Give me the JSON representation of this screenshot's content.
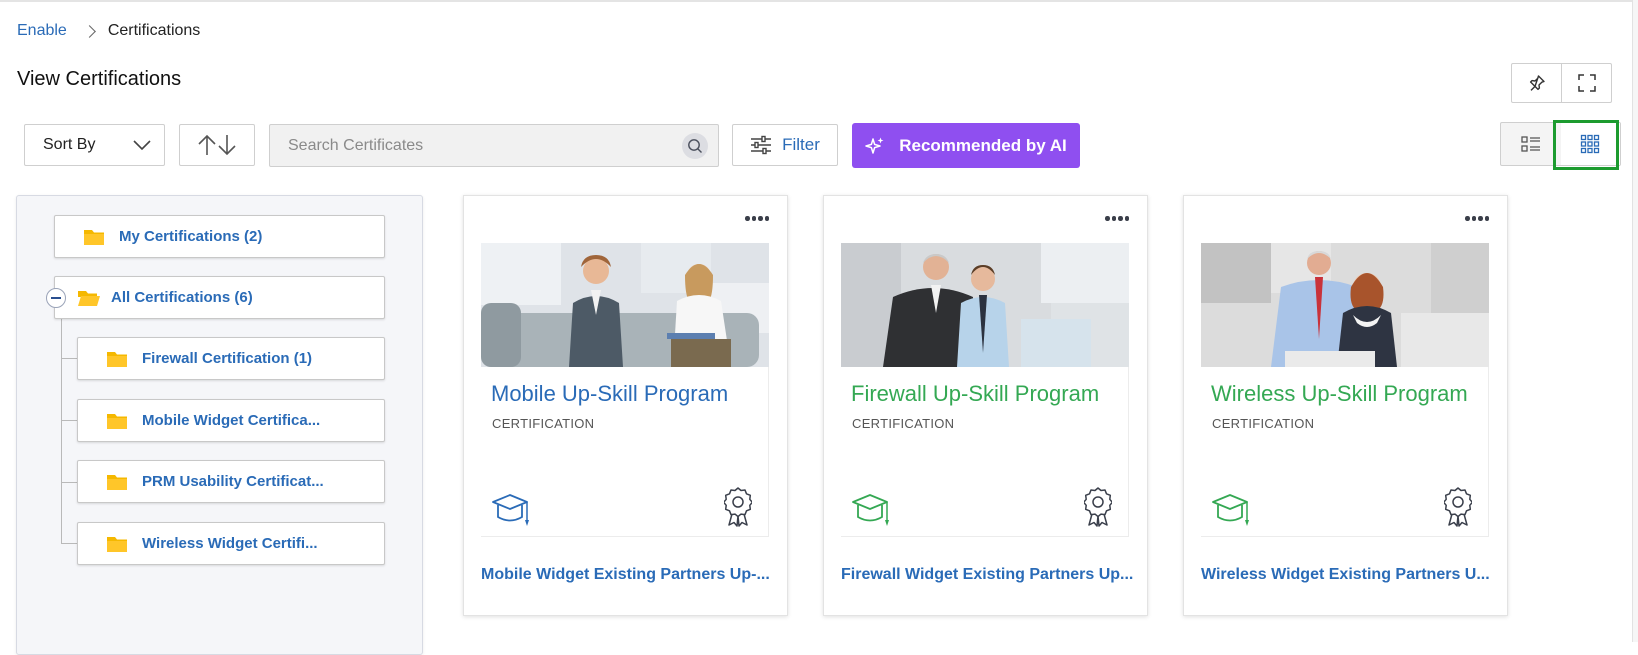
{
  "breadcrumb": {
    "root": "Enable",
    "current": "Certifications"
  },
  "page": {
    "title": "View Certifications"
  },
  "toolbar": {
    "sort_label": "Sort By",
    "search_placeholder": "Search Certificates",
    "filter_label": "Filter",
    "ai_label": "Recommended by AI"
  },
  "tree": {
    "my": "My Certifications (2)",
    "all": "All Certifications (6)",
    "children": [
      "Firewall Certification (1)",
      "Mobile Widget Certifica...",
      "PRM Usability Certificat...",
      "Wireless Widget Certifi..."
    ]
  },
  "cards": [
    {
      "title": "Mobile Up-Skill Program",
      "type": "CERTIFICATION",
      "footer": "Mobile Widget Existing Partners Up-...",
      "accent": "#2a6bb7"
    },
    {
      "title": "Firewall Up-Skill Program",
      "type": "CERTIFICATION",
      "footer": "Firewall Widget Existing Partners Up...",
      "accent": "#34a853"
    },
    {
      "title": "Wireless Up-Skill Program",
      "type": "CERTIFICATION",
      "footer": "Wireless Widget Existing Partners U...",
      "accent": "#34a853"
    }
  ],
  "icons": {
    "pin": "pin-icon",
    "fullscreen": "fullscreen-icon",
    "sort": "chevron-down-icon",
    "sort_order": "sort-order-icon",
    "search": "search-icon",
    "filter": "filter-sliders-icon",
    "ai": "sparkle-icon",
    "list_view": "list-view-icon",
    "grid_view": "grid-view-icon",
    "folder": "folder-icon",
    "graduation": "graduation-cap-icon",
    "badge": "award-badge-icon"
  },
  "colors": {
    "link": "#2a6bb7",
    "ai_button": "#8f4ff0",
    "folder": "#f5b800",
    "green": "#34a853",
    "highlight": "#1c9b2f"
  }
}
